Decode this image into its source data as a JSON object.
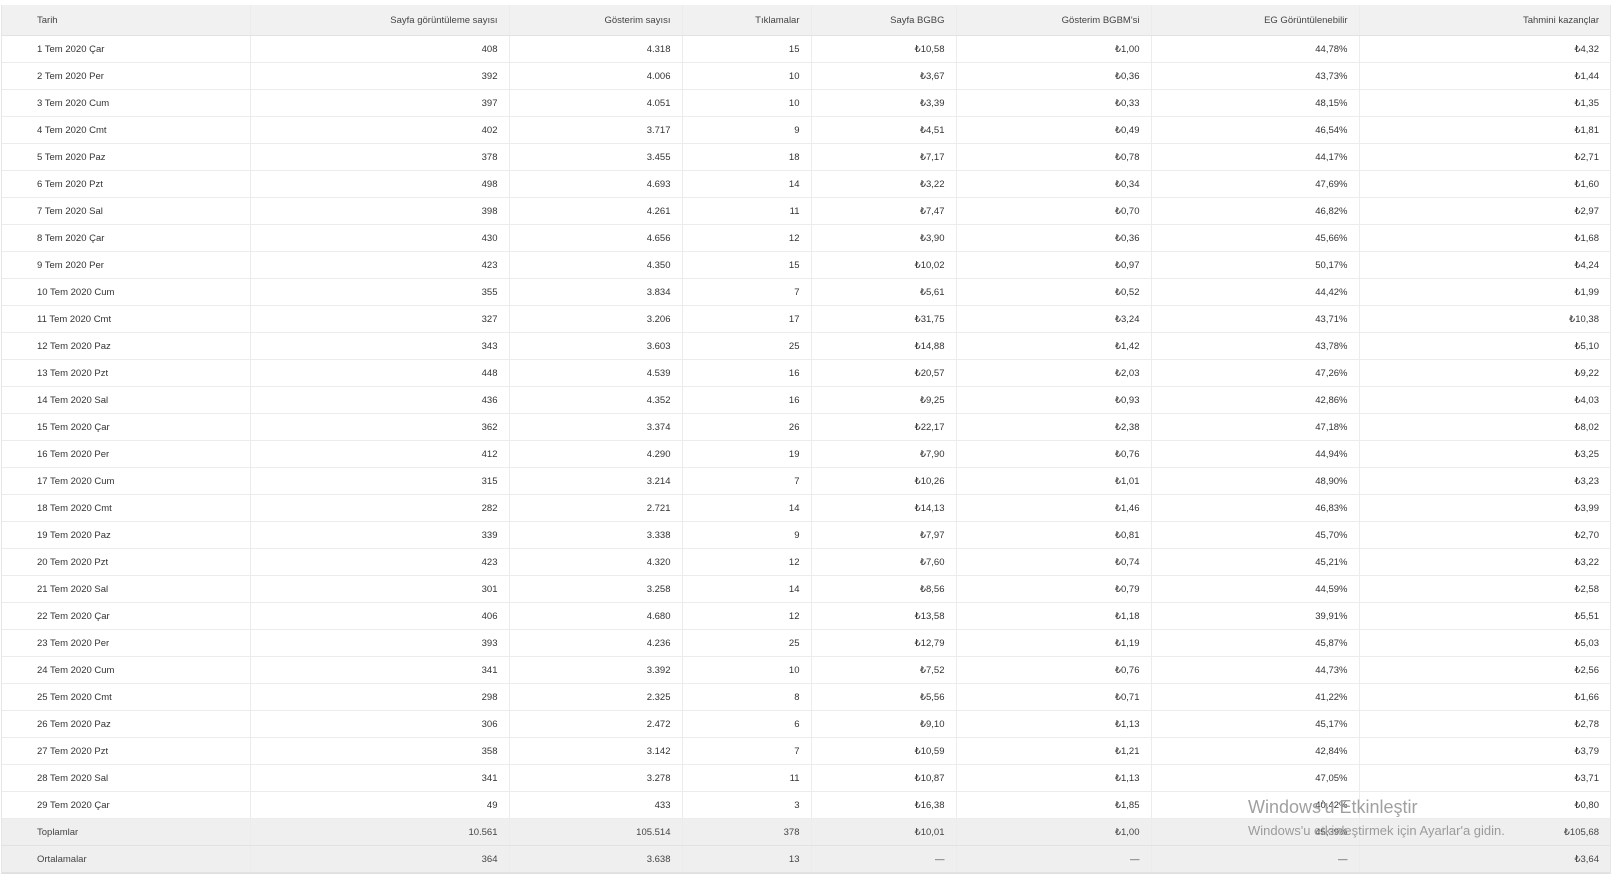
{
  "table": {
    "columns": [
      "Tarih",
      "Sayfa görüntüleme sayısı",
      "Gösterim sayısı",
      "Tıklamalar",
      "Sayfa BGBG",
      "Gösterim BGBM'si",
      "EG Görüntülenebilir",
      "Tahmini kazançlar"
    ],
    "rows": [
      [
        "1 Tem 2020 Çar",
        "408",
        "4.318",
        "15",
        "₺10,58",
        "₺1,00",
        "44,78%",
        "₺4,32"
      ],
      [
        "2 Tem 2020 Per",
        "392",
        "4.006",
        "10",
        "₺3,67",
        "₺0,36",
        "43,73%",
        "₺1,44"
      ],
      [
        "3 Tem 2020 Cum",
        "397",
        "4.051",
        "10",
        "₺3,39",
        "₺0,33",
        "48,15%",
        "₺1,35"
      ],
      [
        "4 Tem 2020 Cmt",
        "402",
        "3.717",
        "9",
        "₺4,51",
        "₺0,49",
        "46,54%",
        "₺1,81"
      ],
      [
        "5 Tem 2020 Paz",
        "378",
        "3.455",
        "18",
        "₺7,17",
        "₺0,78",
        "44,17%",
        "₺2,71"
      ],
      [
        "6 Tem 2020 Pzt",
        "498",
        "4.693",
        "14",
        "₺3,22",
        "₺0,34",
        "47,69%",
        "₺1,60"
      ],
      [
        "7 Tem 2020 Sal",
        "398",
        "4.261",
        "11",
        "₺7,47",
        "₺0,70",
        "46,82%",
        "₺2,97"
      ],
      [
        "8 Tem 2020 Çar",
        "430",
        "4.656",
        "12",
        "₺3,90",
        "₺0,36",
        "45,66%",
        "₺1,68"
      ],
      [
        "9 Tem 2020 Per",
        "423",
        "4.350",
        "15",
        "₺10,02",
        "₺0,97",
        "50,17%",
        "₺4,24"
      ],
      [
        "10 Tem 2020 Cum",
        "355",
        "3.834",
        "7",
        "₺5,61",
        "₺0,52",
        "44,42%",
        "₺1,99"
      ],
      [
        "11 Tem 2020 Cmt",
        "327",
        "3.206",
        "17",
        "₺31,75",
        "₺3,24",
        "43,71%",
        "₺10,38"
      ],
      [
        "12 Tem 2020 Paz",
        "343",
        "3.603",
        "25",
        "₺14,88",
        "₺1,42",
        "43,78%",
        "₺5,10"
      ],
      [
        "13 Tem 2020 Pzt",
        "448",
        "4.539",
        "16",
        "₺20,57",
        "₺2,03",
        "47,26%",
        "₺9,22"
      ],
      [
        "14 Tem 2020 Sal",
        "436",
        "4.352",
        "16",
        "₺9,25",
        "₺0,93",
        "42,86%",
        "₺4,03"
      ],
      [
        "15 Tem 2020 Çar",
        "362",
        "3.374",
        "26",
        "₺22,17",
        "₺2,38",
        "47,18%",
        "₺8,02"
      ],
      [
        "16 Tem 2020 Per",
        "412",
        "4.290",
        "19",
        "₺7,90",
        "₺0,76",
        "44,94%",
        "₺3,25"
      ],
      [
        "17 Tem 2020 Cum",
        "315",
        "3.214",
        "7",
        "₺10,26",
        "₺1,01",
        "48,90%",
        "₺3,23"
      ],
      [
        "18 Tem 2020 Cmt",
        "282",
        "2.721",
        "14",
        "₺14,13",
        "₺1,46",
        "46,83%",
        "₺3,99"
      ],
      [
        "19 Tem 2020 Paz",
        "339",
        "3.338",
        "9",
        "₺7,97",
        "₺0,81",
        "45,70%",
        "₺2,70"
      ],
      [
        "20 Tem 2020 Pzt",
        "423",
        "4.320",
        "12",
        "₺7,60",
        "₺0,74",
        "45,21%",
        "₺3,22"
      ],
      [
        "21 Tem 2020 Sal",
        "301",
        "3.258",
        "14",
        "₺8,56",
        "₺0,79",
        "44,59%",
        "₺2,58"
      ],
      [
        "22 Tem 2020 Çar",
        "406",
        "4.680",
        "12",
        "₺13,58",
        "₺1,18",
        "39,91%",
        "₺5,51"
      ],
      [
        "23 Tem 2020 Per",
        "393",
        "4.236",
        "25",
        "₺12,79",
        "₺1,19",
        "45,87%",
        "₺5,03"
      ],
      [
        "24 Tem 2020 Cum",
        "341",
        "3.392",
        "10",
        "₺7,52",
        "₺0,76",
        "44,73%",
        "₺2,56"
      ],
      [
        "25 Tem 2020 Cmt",
        "298",
        "2.325",
        "8",
        "₺5,56",
        "₺0,71",
        "41,22%",
        "₺1,66"
      ],
      [
        "26 Tem 2020 Paz",
        "306",
        "2.472",
        "6",
        "₺9,10",
        "₺1,13",
        "45,17%",
        "₺2,78"
      ],
      [
        "27 Tem 2020 Pzt",
        "358",
        "3.142",
        "7",
        "₺10,59",
        "₺1,21",
        "42,84%",
        "₺3,79"
      ],
      [
        "28 Tem 2020 Sal",
        "341",
        "3.278",
        "11",
        "₺10,87",
        "₺1,13",
        "47,05%",
        "₺3,71"
      ],
      [
        "29 Tem 2020 Çar",
        "49",
        "433",
        "3",
        "₺16,38",
        "₺1,85",
        "40,42%",
        "₺0,80"
      ]
    ],
    "totals": [
      "Toplamlar",
      "10.561",
      "105.514",
      "378",
      "₺10,01",
      "₺1,00",
      "45,39%",
      "₺105,68"
    ],
    "averages": [
      "Ortalamalar",
      "364",
      "3.638",
      "13",
      "—",
      "—",
      "—",
      "₺3,64"
    ]
  },
  "watermark": {
    "title": "Windows'u Etkinleştir",
    "subtitle": "Windows'u etkinleştirmek için Ayarlar'a gidin."
  }
}
